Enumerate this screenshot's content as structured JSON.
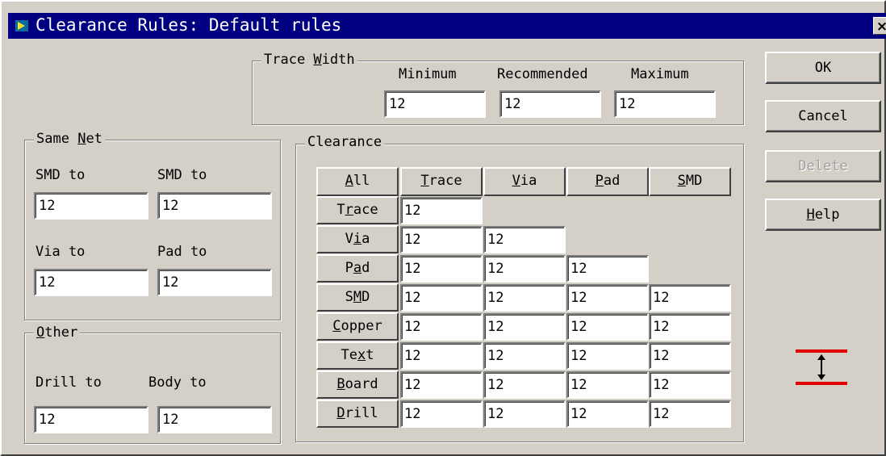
{
  "window": {
    "title": "Clearance Rules: Default rules",
    "close_label": "×"
  },
  "trace_width": {
    "legend": "Trace Width",
    "minimum_label": "Minimum",
    "recommended_label": "Recommended",
    "maximum_label": "Maximum",
    "minimum": "12",
    "recommended": "12",
    "maximum": "12"
  },
  "same_net": {
    "legend": "Same Net",
    "smd_to_1_label": "SMD to",
    "smd_to_2_label": "SMD to",
    "via_to_label": "Via to",
    "pad_to_label": "Pad to",
    "smd_to_1": "12",
    "smd_to_2": "12",
    "via_to": "12",
    "pad_to": "12"
  },
  "other": {
    "legend": "Other",
    "drill_to_label": "Drill to",
    "body_to_label": "Body to",
    "drill_to": "12",
    "body_to": "12"
  },
  "clearance": {
    "legend": "Clearance",
    "all_label": "All",
    "columns": [
      "Trace",
      "Via",
      "Pad",
      "SMD"
    ],
    "rows": [
      {
        "label": "Trace",
        "values": [
          "12"
        ]
      },
      {
        "label": "Via",
        "values": [
          "12",
          "12"
        ]
      },
      {
        "label": "Pad",
        "values": [
          "12",
          "12",
          "12"
        ]
      },
      {
        "label": "SMD",
        "values": [
          "12",
          "12",
          "12",
          "12"
        ]
      },
      {
        "label": "Copper",
        "values": [
          "12",
          "12",
          "12",
          "12"
        ]
      },
      {
        "label": "Text",
        "values": [
          "12",
          "12",
          "12",
          "12"
        ]
      },
      {
        "label": "Board",
        "values": [
          "12",
          "12",
          "12",
          "12"
        ]
      },
      {
        "label": "Drill",
        "values": [
          "12",
          "12",
          "12",
          "12"
        ]
      }
    ]
  },
  "buttons": {
    "ok": "OK",
    "cancel": "Cancel",
    "delete": "Delete",
    "help": "Help"
  },
  "colors": {
    "titlebar": "#000080",
    "clearance_icon": "#e00000"
  },
  "icons": {
    "app": "app-icon",
    "clearance": "clearance-diagram-icon"
  }
}
